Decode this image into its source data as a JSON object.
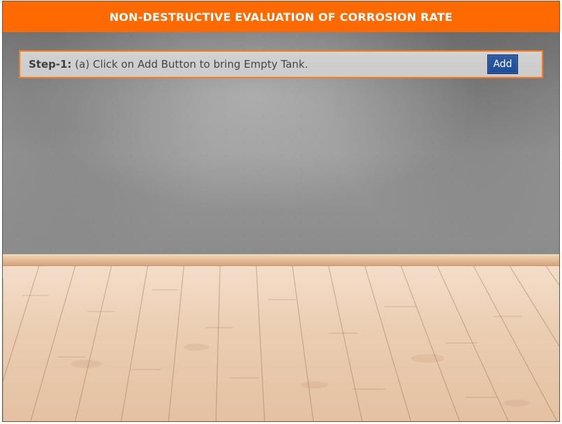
{
  "app": {
    "title": "NON-DESTRUCTIVE EVALUATION OF CORROSION RATE"
  },
  "step": {
    "label": "Step-1:",
    "instruction": "(a) Click on Add Button to bring Empty Tank.",
    "button_label": "Add"
  },
  "colors": {
    "title_bar": "#ff6a00",
    "panel_border": "#ff7a1a",
    "button": "#1f4c97",
    "wall": "#8d8d8d",
    "floor": "#e4c1a2"
  }
}
